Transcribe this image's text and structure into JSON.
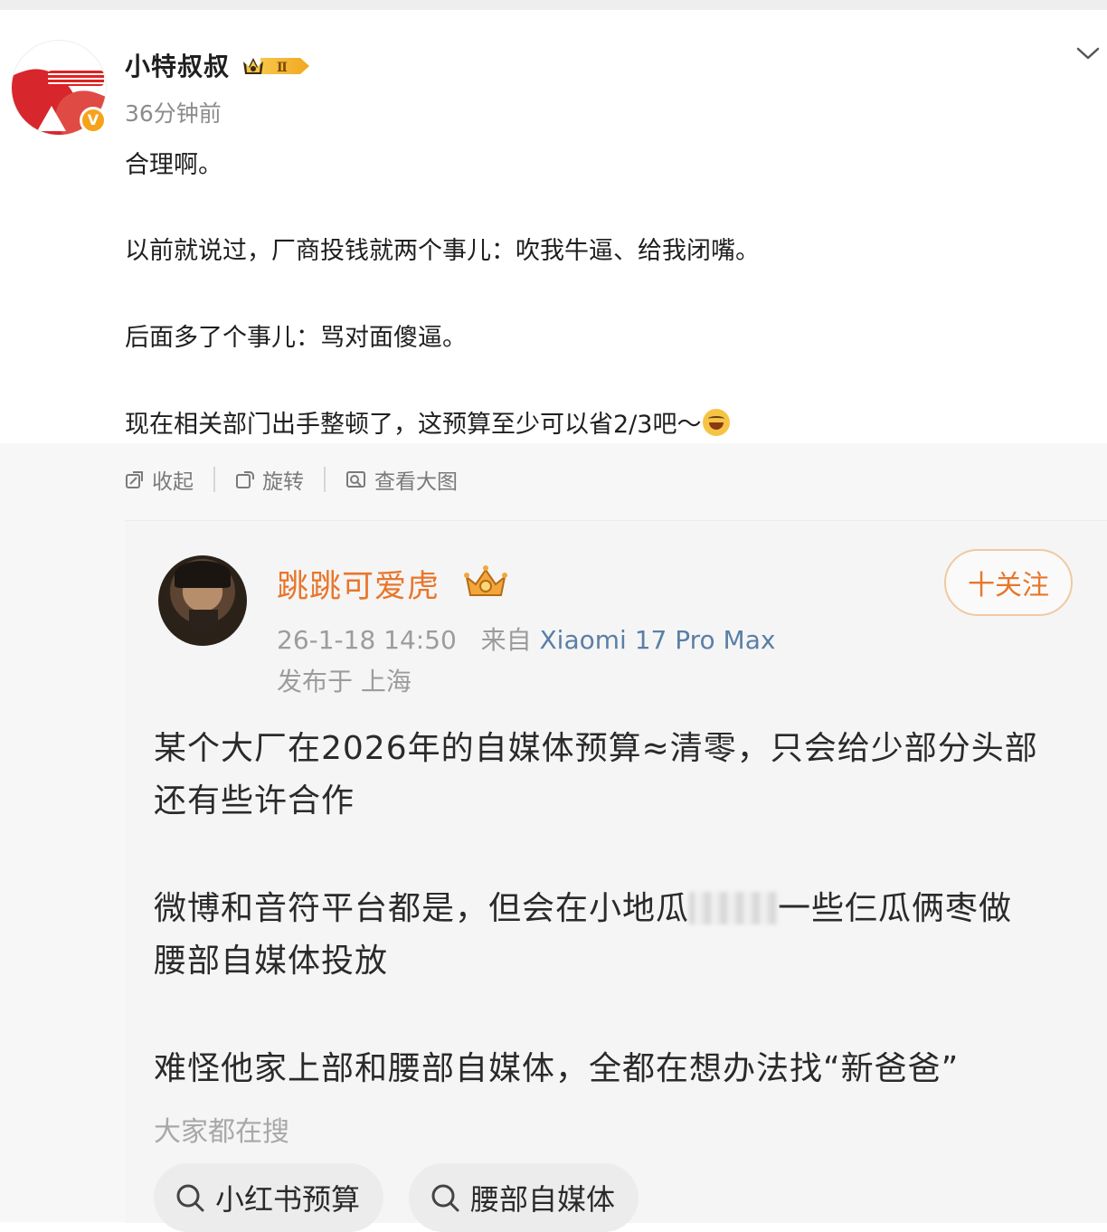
{
  "author": {
    "name": "小特叔叔",
    "level_badge": "Ⅱ",
    "verified_mark": "V",
    "time": "36分钟前"
  },
  "post": {
    "lines": [
      "合理啊。",
      "以前就说过，厂商投钱就两个事儿：吹我牛逼、给我闭嘴。",
      "后面多了个事儿：骂对面傻逼。",
      "现在相关部门出手整顿了，这预算至少可以省2/3吧～"
    ],
    "emoji": "rofl-emoji"
  },
  "image_toolbar": {
    "collapse": "收起",
    "rotate": "旋转",
    "view_large": "查看大图"
  },
  "quoted": {
    "name": "跳跳可爱虎",
    "follow": "十关注",
    "datetime": "26-1-18 14:50",
    "from_label": "来自",
    "device": "Xiaomi 17 Pro Max",
    "location": "发布于 上海",
    "p1_line1": "某个大厂在2026年的自媒体预算≈清零，只会给少部分头部",
    "p1_line2": "还有些许合作",
    "p2_line1_a": "微博和音符平台都是，但会在小地瓜",
    "p2_line1_b": "一些仨瓜俩枣做",
    "p2_line2": "腰部自媒体投放",
    "p3": "难怪他家上部和腰部自媒体，全都在想办法找“新爸爸”",
    "search_title": "大家都在搜",
    "search_chips": [
      "小红书预算",
      "腰部自媒体"
    ]
  },
  "colors": {
    "accent_orange": "#e8762b",
    "link_blue": "#5b7fa6",
    "muted_gray": "#8c8c8c"
  }
}
